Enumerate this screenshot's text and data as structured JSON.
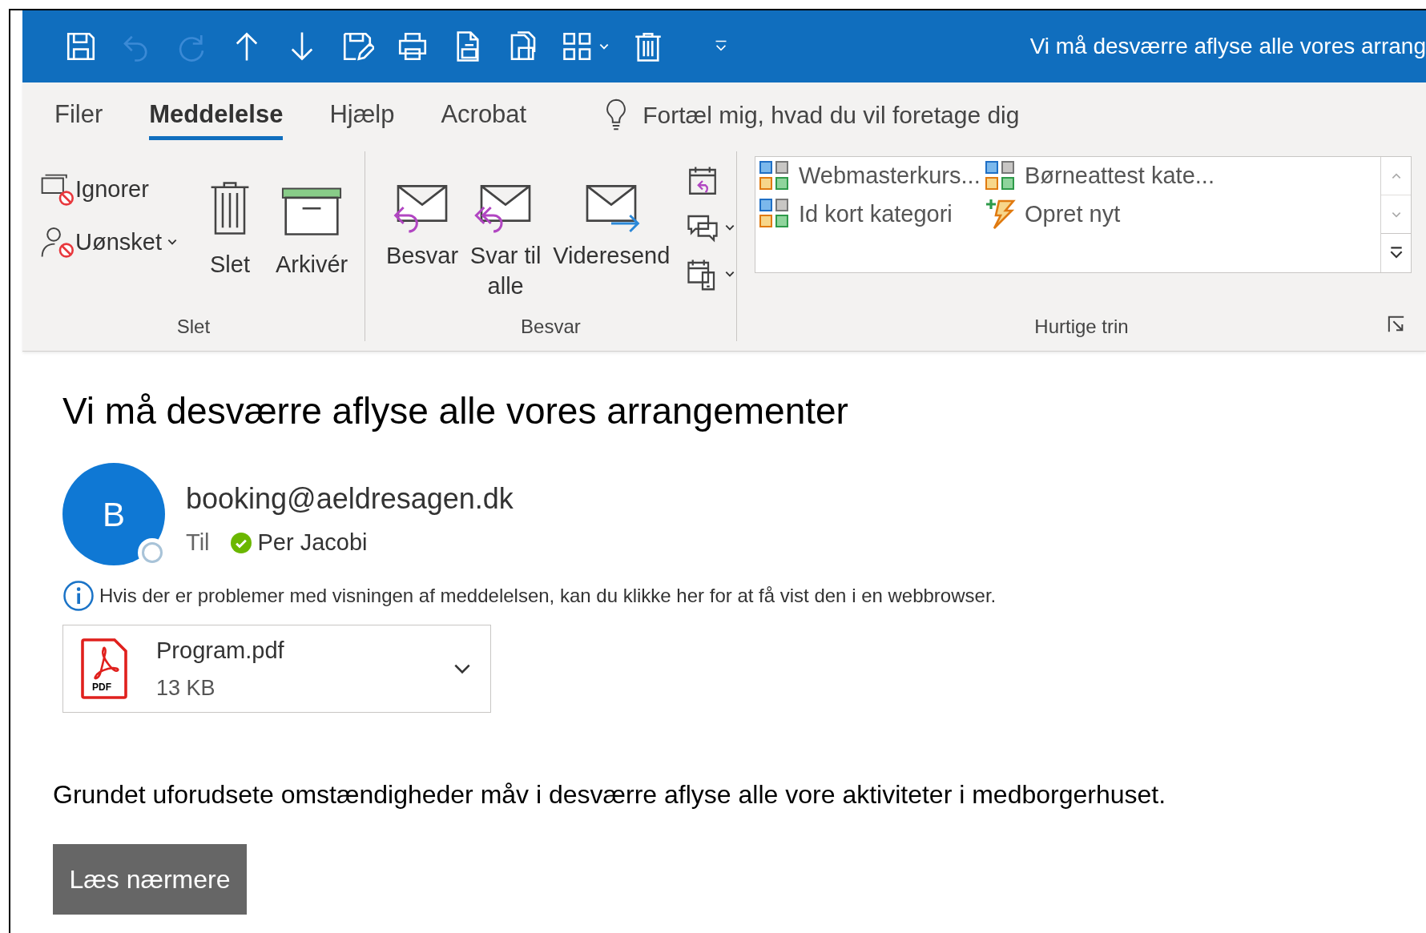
{
  "quick_access_toolbar": [
    {
      "kind": "save",
      "disabled": false
    },
    {
      "kind": "undo",
      "disabled": true
    },
    {
      "kind": "redo",
      "disabled": true
    },
    {
      "kind": "up",
      "disabled": false
    },
    {
      "kind": "down",
      "disabled": false
    },
    {
      "kind": "form",
      "disabled": false
    },
    {
      "kind": "print",
      "disabled": false
    },
    {
      "kind": "preview",
      "disabled": false
    },
    {
      "kind": "copy",
      "disabled": false
    },
    {
      "kind": "grid",
      "disabled": false
    },
    {
      "kind": "trash",
      "disabled": false
    },
    {
      "kind": "customize",
      "disabled": false
    }
  ],
  "window": {
    "title": "Vi må desværre aflyse alle vores arrang"
  },
  "tabs": [
    {
      "label": "Filer",
      "selected": false
    },
    {
      "label": "Meddelelse",
      "selected": true
    },
    {
      "label": "Hjælp",
      "selected": false
    },
    {
      "label": "Acrobat",
      "selected": false
    }
  ],
  "tell_me": {
    "placeholder": "Fortæl mig, hvad du vil foretage dig"
  },
  "ribbon_groups": [
    {
      "label": "Slet",
      "commands": [
        {
          "kind": "ignore",
          "label": "Ignorer"
        },
        {
          "kind": "junk",
          "label": "Uønsket"
        },
        {
          "kind": "delete",
          "label": "Slet"
        },
        {
          "kind": "archive",
          "label": "Arkivér"
        }
      ]
    },
    {
      "label": "Besvar",
      "commands": [
        {
          "kind": "reply",
          "label": "Besvar"
        },
        {
          "kind": "reply_all",
          "label": "Svar til alle"
        },
        {
          "kind": "forward",
          "label": "Videresend"
        },
        {
          "kind": "meeting_reply"
        },
        {
          "kind": "im_reply"
        },
        {
          "kind": "more_reply"
        }
      ]
    },
    {
      "label": "Hurtige trin",
      "commands": [
        {
          "kind": "category",
          "label": "Webmasterkurs..."
        },
        {
          "kind": "category",
          "label": "Børneattest kate..."
        },
        {
          "kind": "category",
          "label": "Id kort kategori"
        },
        {
          "kind": "create",
          "label": "Opret nyt"
        }
      ]
    }
  ],
  "message": {
    "subject": "Vi må desværre aflyse alle vores arrangementer",
    "sender": {
      "initial": "B",
      "address": "booking@aeldresagen.dk"
    },
    "to_label": "Til",
    "recipient": "Per Jacobi",
    "info": "Hvis der er problemer med visningen af meddelelsen, kan du klikke her for at få vist den i en webbrowser.",
    "attachment": {
      "type_label": "PDF",
      "name": "Program.pdf",
      "size": "13 KB"
    },
    "body": "Grundet uforudsete omstændigheder måv i desværre aflyse alle vore aktiviteter i medborgerhuset.",
    "button": "Læs nærmere"
  }
}
